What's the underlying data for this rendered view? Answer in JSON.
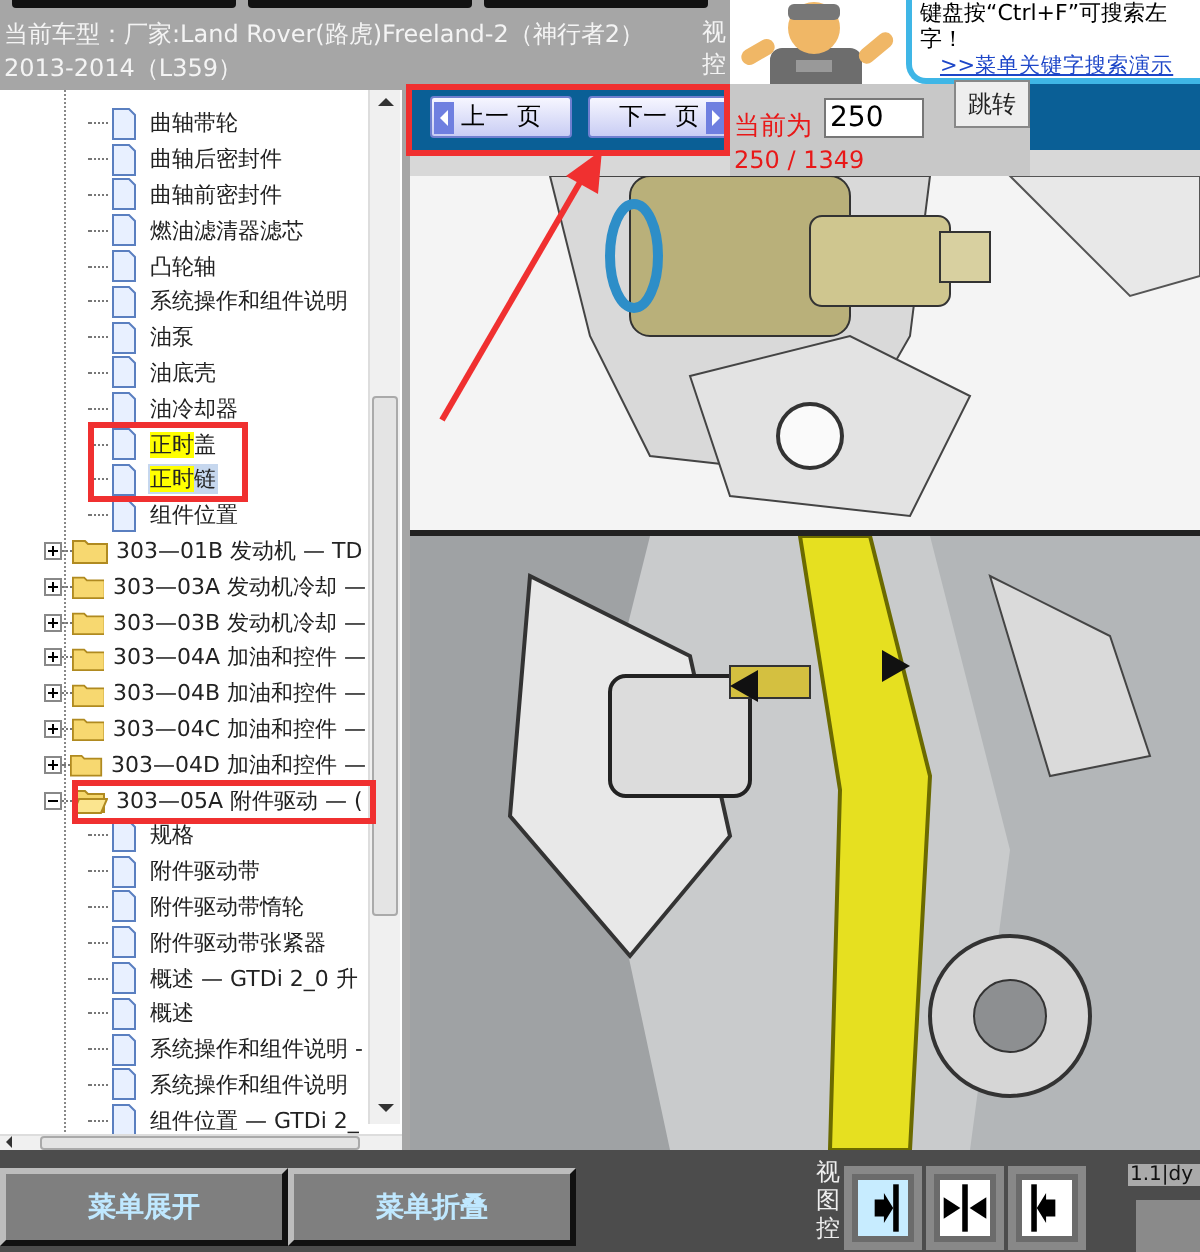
{
  "header": {
    "vehicle_line1": "当前车型：厂家:Land Rover(路虎)Freeland-2（神行者2）",
    "vehicle_line2": "2013-2014（L359）",
    "side_label": "视控"
  },
  "promo": {
    "hint_line1": "键盘按“Ctrl+F”可搜索左",
    "hint_line2": "字！",
    "link": ">>菜单关键字搜索演示"
  },
  "pager": {
    "prev": "上一 页",
    "next": "下一 页",
    "current_label": "当前为",
    "page_value": "250",
    "go": "跳转",
    "position": "250 / 1349"
  },
  "tree": {
    "continued_pages": [
      {
        "parts": [
          {
            "text": "曲轴带轮",
            "highlighted": false
          }
        ],
        "selected": false
      },
      {
        "parts": [
          {
            "text": "曲轴后密封件",
            "highlighted": false
          }
        ],
        "selected": false
      },
      {
        "parts": [
          {
            "text": "曲轴前密封件",
            "highlighted": false
          }
        ],
        "selected": false
      },
      {
        "parts": [
          {
            "text": "燃油滤清器滤芯",
            "highlighted": false
          }
        ],
        "selected": false
      },
      {
        "parts": [
          {
            "text": "凸轮轴",
            "highlighted": false
          }
        ],
        "selected": false
      },
      {
        "parts": [
          {
            "text": "系统操作和组件说明",
            "highlighted": false
          }
        ],
        "selected": false
      },
      {
        "parts": [
          {
            "text": "油泵",
            "highlighted": false
          }
        ],
        "selected": false
      },
      {
        "parts": [
          {
            "text": "油底壳",
            "highlighted": false
          }
        ],
        "selected": false
      },
      {
        "parts": [
          {
            "text": "油冷却器",
            "highlighted": false
          }
        ],
        "selected": false
      },
      {
        "parts": [
          {
            "text": "正时",
            "highlighted": true
          },
          {
            "text": "盖",
            "highlighted": false
          }
        ],
        "selected": false
      },
      {
        "parts": [
          {
            "text": "正时",
            "highlighted": true
          },
          {
            "text": "链",
            "highlighted": false
          }
        ],
        "selected": true
      },
      {
        "parts": [
          {
            "text": "组件位置",
            "highlighted": false
          }
        ],
        "selected": false
      }
    ],
    "folders": [
      {
        "label": "303—01B 发动机 — TD",
        "expanded": false
      },
      {
        "label": "303—03A 发动机冷却 —",
        "expanded": false
      },
      {
        "label": "303—03B 发动机冷却 —",
        "expanded": false
      },
      {
        "label": "303—04A 加油和控件 —",
        "expanded": false
      },
      {
        "label": "303—04B 加油和控件 —",
        "expanded": false
      },
      {
        "label": "303—04C 加油和控件 —",
        "expanded": false
      },
      {
        "label": "303—04D 加油和控件 —",
        "expanded": false
      },
      {
        "label": "303—05A 附件驱动 — (",
        "expanded": true,
        "children": [
          {
            "parts": [
              {
                "text": "规格",
                "highlighted": false
              }
            ],
            "selected": false
          },
          {
            "parts": [
              {
                "text": "附件驱动带",
                "highlighted": false
              }
            ],
            "selected": false
          },
          {
            "parts": [
              {
                "text": "附件驱动带惰轮",
                "highlighted": false
              }
            ],
            "selected": false
          },
          {
            "parts": [
              {
                "text": "附件驱动带张紧器",
                "highlighted": false
              }
            ],
            "selected": false
          },
          {
            "parts": [
              {
                "text": "概述 — GTDi 2_0 升",
                "highlighted": false
              }
            ],
            "selected": false
          },
          {
            "parts": [
              {
                "text": "概述",
                "highlighted": false
              }
            ],
            "selected": false
          },
          {
            "parts": [
              {
                "text": "系统操作和组件说明 -",
                "highlighted": false
              }
            ],
            "selected": false
          },
          {
            "parts": [
              {
                "text": "系统操作和组件说明",
                "highlighted": false
              }
            ],
            "selected": false
          },
          {
            "parts": [
              {
                "text": "组件位置 — GTDi 2_",
                "highlighted": false
              }
            ],
            "selected": false
          }
        ]
      }
    ]
  },
  "bottom": {
    "buttons": [
      "菜单展开",
      "菜单折叠"
    ],
    "view_label": "视图控",
    "view_buttons": [
      {
        "kind": "right",
        "selected": true
      },
      {
        "kind": "both",
        "selected": false
      },
      {
        "kind": "left",
        "selected": false
      }
    ],
    "version": "1.1|dy"
  }
}
